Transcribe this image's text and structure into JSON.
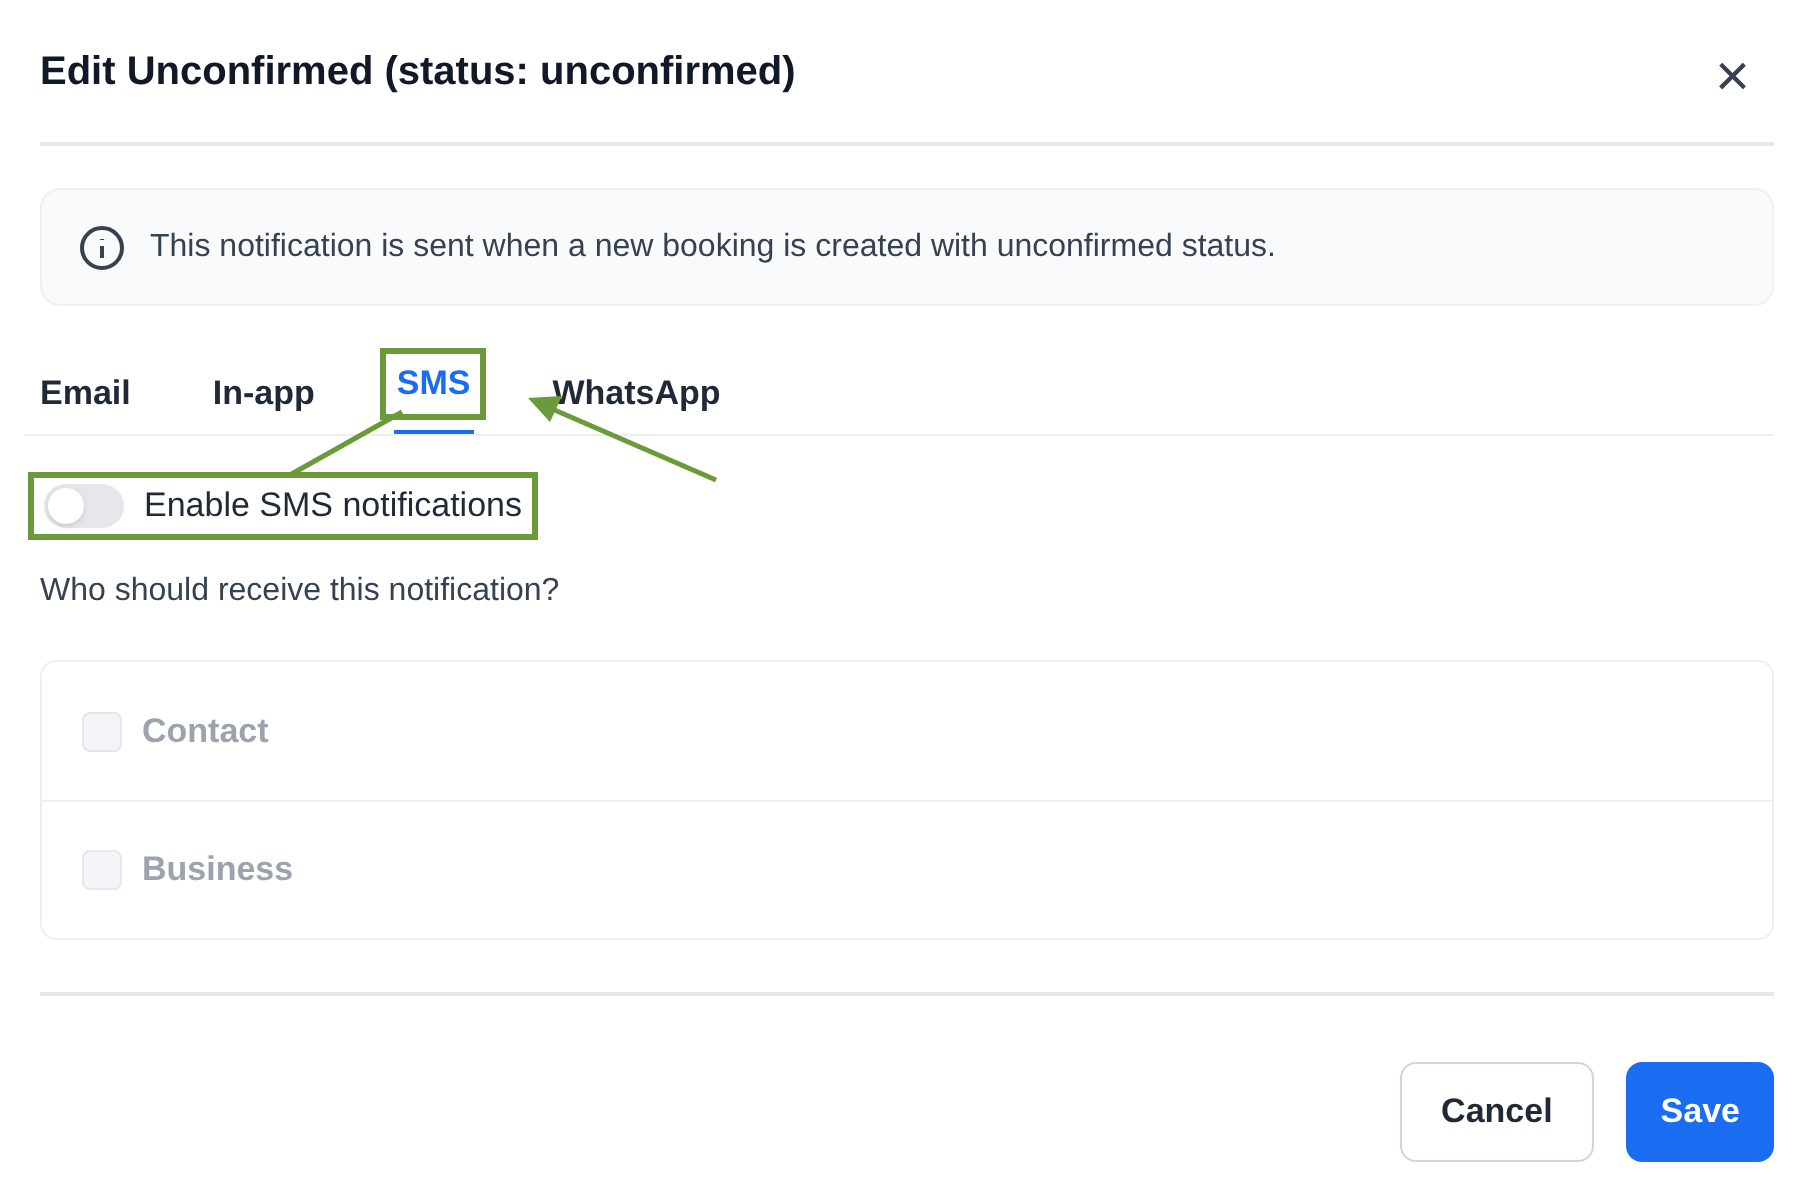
{
  "dialog": {
    "title": "Edit Unconfirmed (status: unconfirmed)",
    "close": "×"
  },
  "info": "This notification is sent when a new booking is created with unconfirmed status.",
  "tabs": [
    {
      "label": "Email",
      "selected": false,
      "highlighted": false
    },
    {
      "label": "In-app",
      "selected": false,
      "highlighted": false
    },
    {
      "label": "SMS",
      "selected": true,
      "highlighted": true
    },
    {
      "label": "WhatsApp",
      "selected": false,
      "highlighted": false
    }
  ],
  "toggle": {
    "label": "Enable SMS notifications",
    "on": false,
    "highlighted": true
  },
  "recipients": {
    "question": "Who should receive this notification?",
    "options": [
      {
        "label": "Contact",
        "checked": false,
        "disabled": true
      },
      {
        "label": "Business",
        "checked": false,
        "disabled": true
      }
    ]
  },
  "buttons": [
    {
      "label": "Cancel",
      "kind": "secondary"
    },
    {
      "label": "Save",
      "kind": "primary"
    }
  ]
}
